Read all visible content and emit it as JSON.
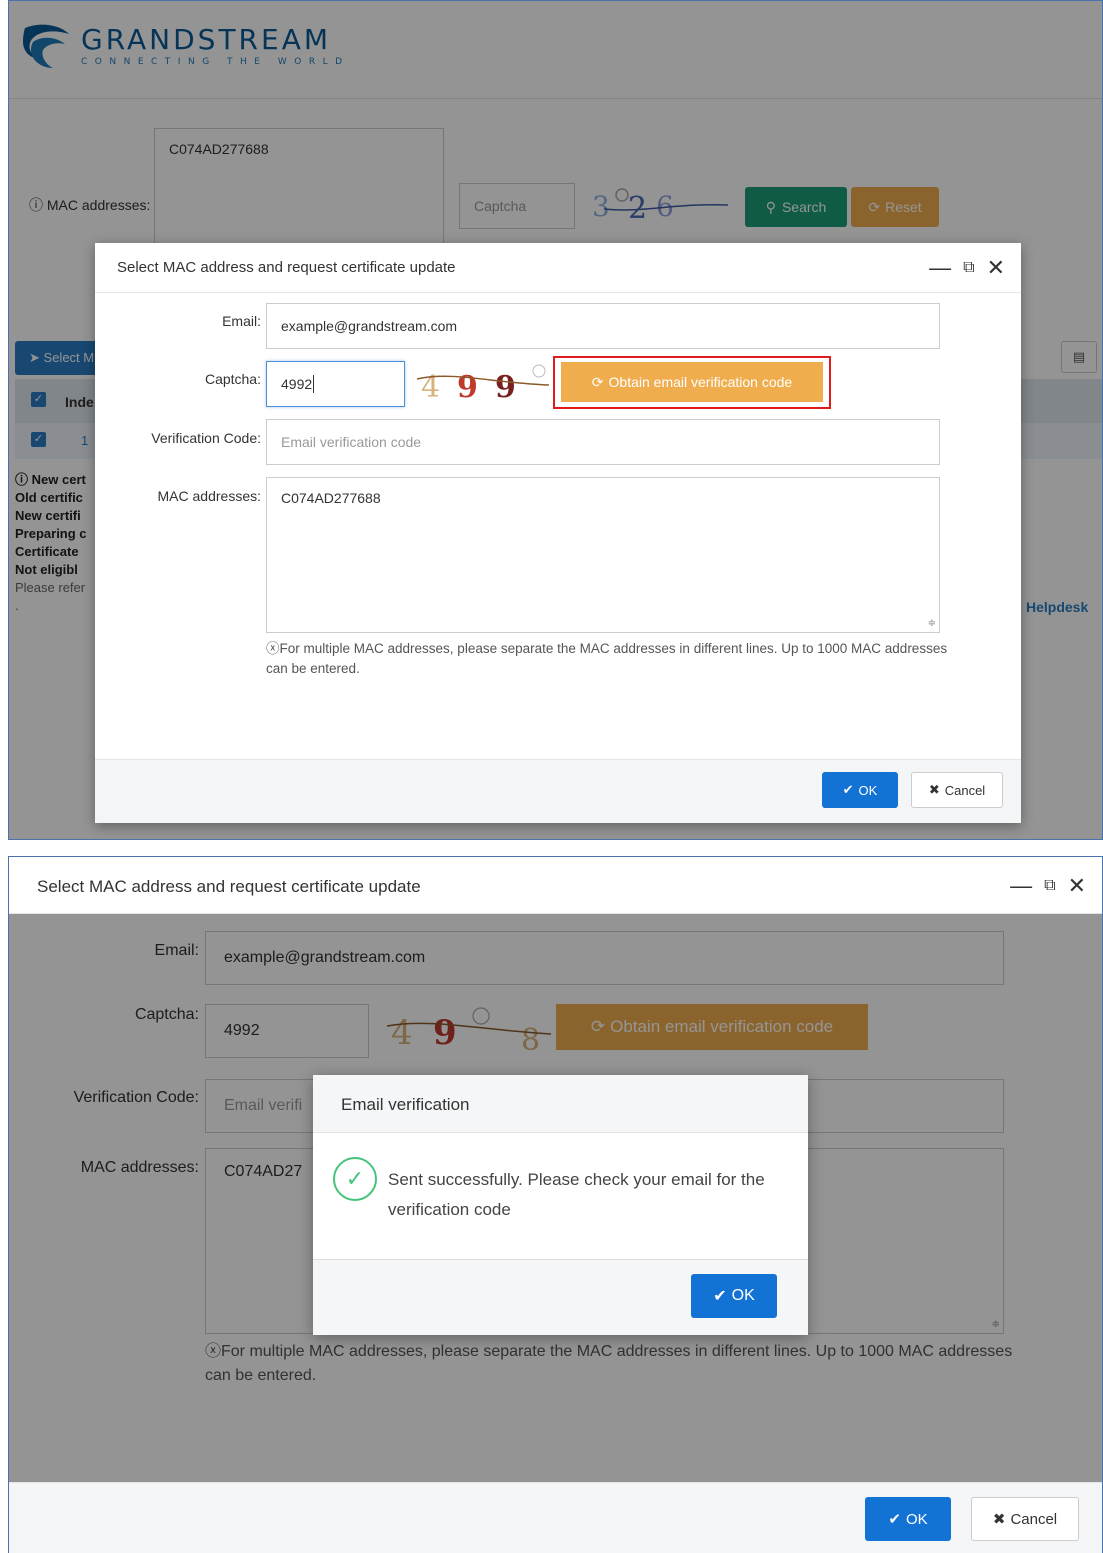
{
  "brand": {
    "name": "GRANDSTREAM",
    "tagline": "CONNECTING THE WORLD",
    "primary_color": "#0a5a96"
  },
  "background_page": {
    "mac_label": "MAC addresses:",
    "mac_value": "C074AD277688",
    "captcha_placeholder": "Captcha",
    "captcha_text": "3026",
    "search_label": "Search",
    "reset_label": "Reset",
    "select_button_label": "Select M",
    "table_header_index": "Inde",
    "table_row_index": "1",
    "notes": [
      {
        "text": "New cert",
        "bold": true,
        "help": true
      },
      {
        "text": "Old certific",
        "bold": true
      },
      {
        "text": "New certifi",
        "bold": true
      },
      {
        "text": "Preparing c",
        "bold": true
      },
      {
        "text": "Certificate",
        "bold": true
      },
      {
        "text": "Not eligibl",
        "bold": true
      },
      {
        "text": "Please refer",
        "bold": false
      },
      {
        "text": ".",
        "bold": false
      }
    ],
    "helpdesk_text": "Helpdesk"
  },
  "modal": {
    "title": "Select MAC address and request certificate update",
    "email_label": "Email:",
    "email_value": "example@grandstream.com",
    "captcha_label": "Captcha:",
    "captcha_value": "4992",
    "captcha_image_text": "4998",
    "obtain_button_label": "Obtain email verification code",
    "verification_label": "Verification Code:",
    "verification_placeholder": "Email verification code",
    "mac_label": "MAC addresses:",
    "mac_value": "C074AD277688",
    "hint": "ⓧFor multiple MAC addresses, please separate the MAC addresses in different lines. Up to 1000 MAC addresses can be entered.",
    "ok_label": "OK",
    "cancel_label": "Cancel"
  },
  "second_view": {
    "verification_partial": "Email verifi",
    "mac_partial": "C074AD27"
  },
  "email_dialog": {
    "title": "Email verification",
    "message": "Sent successfully. Please check your email for the verification code",
    "ok_label": "OK"
  },
  "colors": {
    "ok_blue": "#1373d4",
    "obtain_orange": "#f0ad4e",
    "search_green": "#1a9e78",
    "highlight_red": "#e01b1b",
    "success_green": "#46c37b"
  },
  "icons": {
    "ok": "check-icon",
    "cancel": "x-icon",
    "obtain": "refresh-icon",
    "search": "search-icon",
    "success": "check-circle-icon"
  }
}
